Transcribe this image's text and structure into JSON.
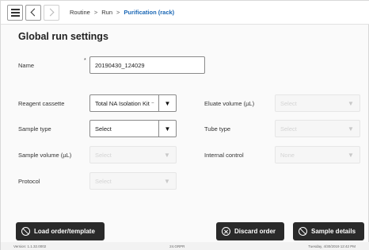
{
  "nav": {
    "crumbs": [
      "Routine",
      "Run",
      "Purification (rack)"
    ],
    "separator": ">"
  },
  "page": {
    "title": "Global run settings"
  },
  "form": {
    "name": {
      "label": "Name",
      "required_mark": "*",
      "value": "20190430_124029"
    },
    "reagent_cassette": {
      "label": "Reagent cassette",
      "value": "Total NA Isolation Kit ⁻"
    },
    "eluate_volume": {
      "label": "Eluate volume (µL)",
      "value": "Select"
    },
    "sample_type": {
      "label": "Sample type",
      "value": "Select"
    },
    "tube_type": {
      "label": "Tube type",
      "value": "Select"
    },
    "sample_volume": {
      "label": "Sample volume (µL)",
      "value": "Select"
    },
    "internal_control": {
      "label": "Internal control",
      "value": "None"
    },
    "protocol": {
      "label": "Protocol",
      "value": "Select"
    },
    "arrow_glyph": "▼"
  },
  "buttons": {
    "load_order": "Load order/template",
    "discard_order": "Discard order",
    "sample_details": "Sample details"
  },
  "status_bar": {
    "version": "Version: 1.1.32.0002",
    "center": "24.GRPR",
    "datetime": "Tuesday, 4/30/2019 12:42 PM"
  }
}
